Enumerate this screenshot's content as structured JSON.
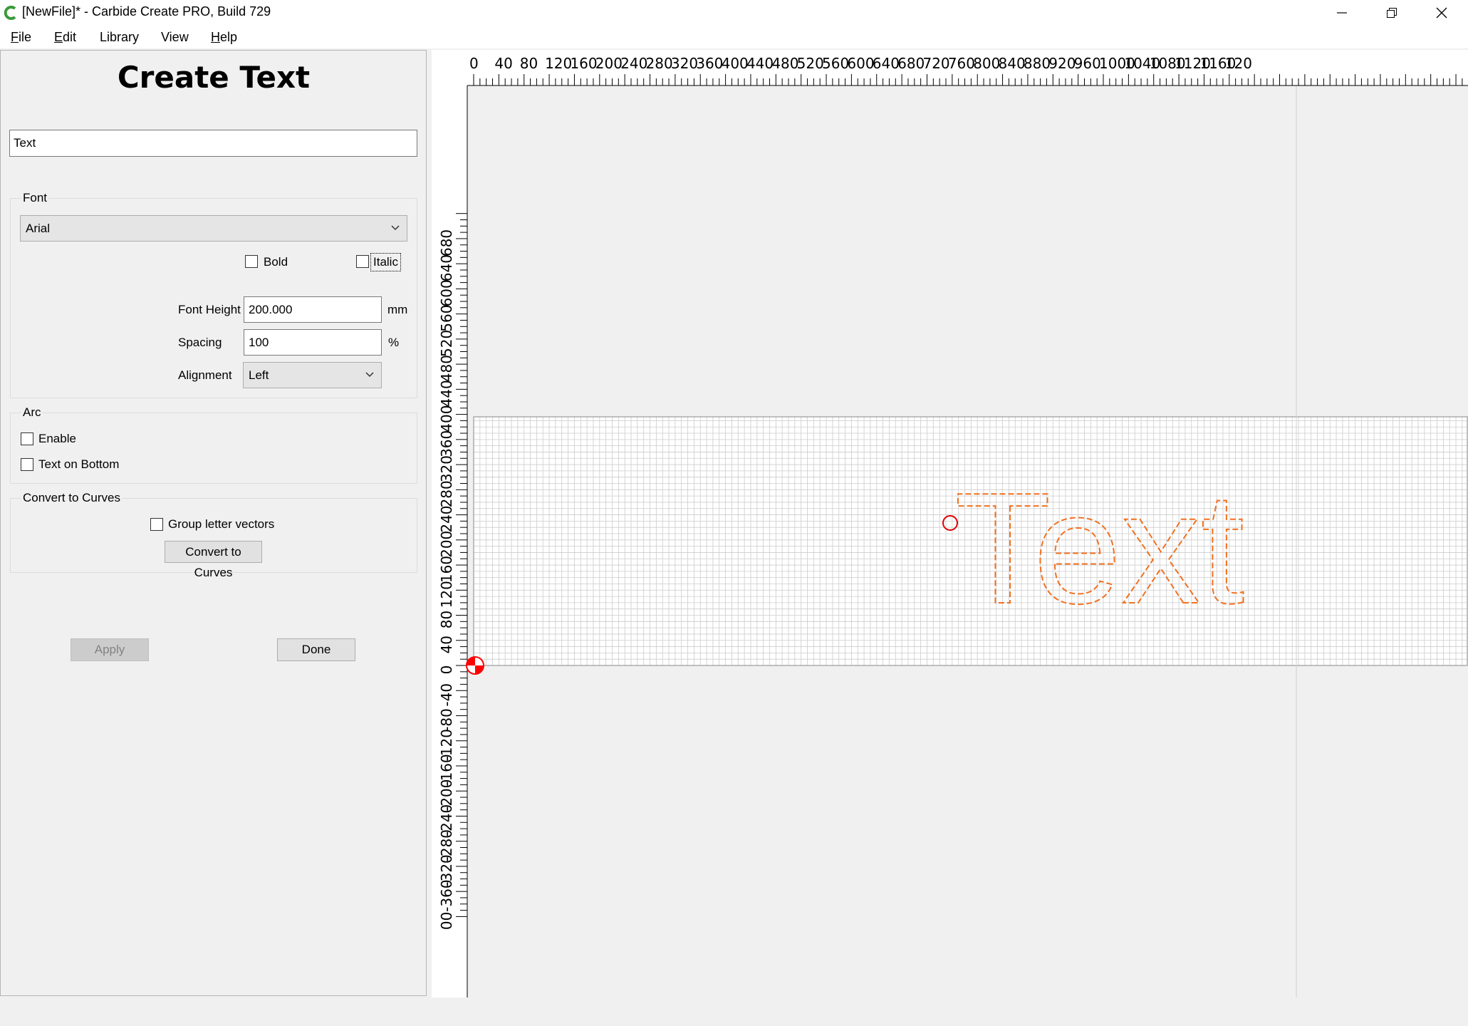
{
  "window": {
    "title": "[NewFile]* - Carbide Create PRO, Build 729",
    "minimize_icon": "minimize-icon",
    "restore_icon": "restore-icon",
    "close_icon": "close-icon"
  },
  "menu": {
    "items": [
      {
        "label": "File",
        "underline": "F",
        "rest": "ile"
      },
      {
        "label": "Edit",
        "underline": "E",
        "rest": "dit"
      },
      {
        "label": "Library",
        "underline": "",
        "rest": "Library"
      },
      {
        "label": "View",
        "underline": "",
        "rest": "View"
      },
      {
        "label": "Help",
        "underline": "H",
        "rest": "elp"
      }
    ]
  },
  "panel": {
    "title": "Create Text",
    "text_value": "Text",
    "font_group": {
      "label": "Font",
      "font_value": "Arial",
      "bold_label": "Bold",
      "italic_label": "Italic",
      "height_label": "Font Height",
      "height_value": "200.000",
      "height_unit": "mm",
      "spacing_label": "Spacing",
      "spacing_value": "100",
      "spacing_unit": "%",
      "alignment_label": "Alignment",
      "alignment_value": "Left"
    },
    "arc_group": {
      "label": "Arc",
      "enable_label": "Enable",
      "bottom_label": "Text on Bottom"
    },
    "curves_group": {
      "label": "Convert to Curves",
      "group_label": "Group letter vectors",
      "button_label": "Convert to Curves"
    },
    "apply_label": "Apply",
    "done_label": "Done"
  },
  "canvas": {
    "ruler_top_labels": [
      "0",
      "40",
      "80",
      "120",
      "160",
      "200",
      "240",
      "280",
      "320",
      "360",
      "400",
      "440",
      "480",
      "520",
      "560",
      "600",
      "640",
      "680",
      "720",
      "760",
      "800",
      "840",
      "880",
      "920",
      "960",
      "1000",
      "1040",
      "1080",
      "1120",
      "1160",
      "120"
    ],
    "ruler_left_labels": [
      "680",
      "640",
      "600",
      "560",
      "520",
      "480",
      "440",
      "400",
      "360",
      "320",
      "280",
      "240",
      "200",
      "160",
      "120",
      "80",
      "40",
      "0",
      "-40",
      "-80",
      "-120",
      "-160",
      "-200",
      "-240",
      "-280",
      "-320",
      "-360",
      "00"
    ],
    "text_preview": "Text",
    "colors": {
      "toolpath": "#f07020",
      "origin": "#ff0000",
      "grid": "#cccccc"
    }
  }
}
